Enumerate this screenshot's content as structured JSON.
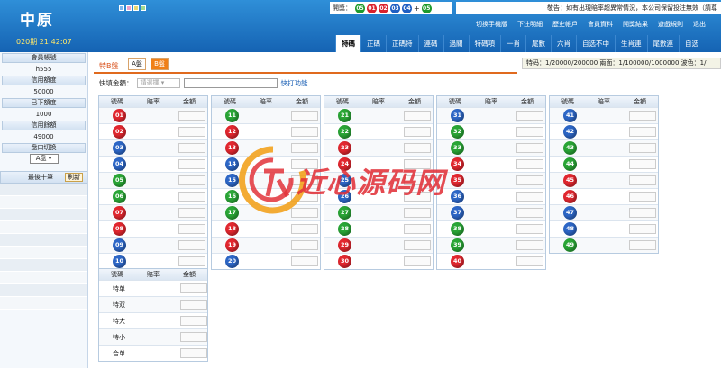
{
  "header": {
    "logo": "中原",
    "issue_time": "020期 21:42:07",
    "draw_label": "開獎：",
    "draw_balls": [
      {
        "num": "05",
        "color": "green"
      },
      {
        "num": "01",
        "color": "red"
      },
      {
        "num": "02",
        "color": "red"
      },
      {
        "num": "03",
        "color": "blue"
      },
      {
        "num": "04",
        "color": "blue"
      },
      {
        "num": "05",
        "color": "green"
      }
    ],
    "draw_plus": "+",
    "notice": "敬告：如有出現賠率超異常情況，本公司保留投注無效（請尊",
    "links": [
      "切換手機版",
      "下注明細",
      "歷史帳戶",
      "會員資料",
      "開獎結果",
      "遊戲規則",
      "退出"
    ],
    "tabs": [
      "特碼",
      "正碼",
      "正碼特",
      "連碼",
      "過關",
      "特碼項",
      "一肖",
      "尾數",
      "六肖",
      "自选不中",
      "生肖連",
      "尾數連",
      "自选"
    ],
    "active_tab": "特碼"
  },
  "sidebar": {
    "fields": [
      {
        "label": "會員帳號",
        "value": "h555"
      },
      {
        "label": "信用額度",
        "value": "50000"
      },
      {
        "label": "已下額度",
        "value": "1000"
      },
      {
        "label": "信用餘額",
        "value": "49000"
      }
    ],
    "switch_label": "盘口切换",
    "switch_value": "A盘",
    "last10_label": "最後十筆",
    "refresh_label": "刷新"
  },
  "sub": {
    "title": "特B盤",
    "btn_a": "A盤",
    "btn_b": "B盤"
  },
  "odds_bar": "特码：1/20000/200000  兩面：1/100000/1000000  波色：1/",
  "quick": {
    "label": "快填金額：",
    "select_placeholder": "請選擇",
    "link": "快打功能"
  },
  "table_headers": {
    "num": "號碼",
    "odds": "賠率",
    "amount": "金額"
  },
  "balls": [
    {
      "num": "01",
      "color": "red"
    },
    {
      "num": "02",
      "color": "red"
    },
    {
      "num": "03",
      "color": "blue"
    },
    {
      "num": "04",
      "color": "blue"
    },
    {
      "num": "05",
      "color": "green"
    },
    {
      "num": "06",
      "color": "green"
    },
    {
      "num": "07",
      "color": "red"
    },
    {
      "num": "08",
      "color": "red"
    },
    {
      "num": "09",
      "color": "blue"
    },
    {
      "num": "10",
      "color": "blue"
    },
    {
      "num": "11",
      "color": "green"
    },
    {
      "num": "12",
      "color": "red"
    },
    {
      "num": "13",
      "color": "red"
    },
    {
      "num": "14",
      "color": "blue"
    },
    {
      "num": "15",
      "color": "blue"
    },
    {
      "num": "16",
      "color": "green"
    },
    {
      "num": "17",
      "color": "green"
    },
    {
      "num": "18",
      "color": "red"
    },
    {
      "num": "19",
      "color": "red"
    },
    {
      "num": "20",
      "color": "blue"
    },
    {
      "num": "21",
      "color": "green"
    },
    {
      "num": "22",
      "color": "green"
    },
    {
      "num": "23",
      "color": "red"
    },
    {
      "num": "24",
      "color": "red"
    },
    {
      "num": "25",
      "color": "blue"
    },
    {
      "num": "26",
      "color": "blue"
    },
    {
      "num": "27",
      "color": "green"
    },
    {
      "num": "28",
      "color": "green"
    },
    {
      "num": "29",
      "color": "red"
    },
    {
      "num": "30",
      "color": "red"
    },
    {
      "num": "31",
      "color": "blue"
    },
    {
      "num": "32",
      "color": "green"
    },
    {
      "num": "33",
      "color": "green"
    },
    {
      "num": "34",
      "color": "red"
    },
    {
      "num": "35",
      "color": "red"
    },
    {
      "num": "36",
      "color": "blue"
    },
    {
      "num": "37",
      "color": "blue"
    },
    {
      "num": "38",
      "color": "green"
    },
    {
      "num": "39",
      "color": "green"
    },
    {
      "num": "40",
      "color": "red"
    },
    {
      "num": "41",
      "color": "blue"
    },
    {
      "num": "42",
      "color": "blue"
    },
    {
      "num": "43",
      "color": "green"
    },
    {
      "num": "44",
      "color": "green"
    },
    {
      "num": "45",
      "color": "red"
    },
    {
      "num": "46",
      "color": "red"
    },
    {
      "num": "47",
      "color": "blue"
    },
    {
      "num": "48",
      "color": "blue"
    },
    {
      "num": "49",
      "color": "green"
    }
  ],
  "special": [
    "特单",
    "特双",
    "特大",
    "特小",
    "合单"
  ],
  "watermark": "近心源码网",
  "colors": {
    "header": "#1c6fc4",
    "red": "#e2272f",
    "green": "#2aa636",
    "blue": "#2d67c7",
    "accent": "#f08018"
  }
}
